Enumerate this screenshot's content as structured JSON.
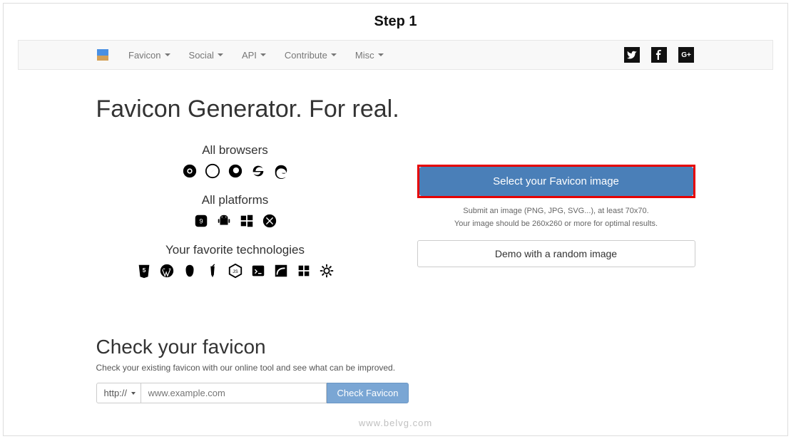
{
  "step_title": "Step 1",
  "nav": {
    "items": [
      "Favicon",
      "Social",
      "API",
      "Contribute",
      "Misc"
    ]
  },
  "main_title": "Favicon Generator. For real.",
  "sections": {
    "browsers": "All browsers",
    "platforms": "All platforms",
    "tech": "Your favorite technologies"
  },
  "action": {
    "select_btn": "Select your Favicon image",
    "hint1": "Submit an image (PNG, JPG, SVG...), at least 70x70.",
    "hint2": "Your image should be 260x260 or more for optimal results.",
    "demo_btn": "Demo with a random image"
  },
  "check": {
    "title": "Check your favicon",
    "sub": "Check your existing favicon with our online tool and see what can be improved.",
    "proto": "http://",
    "placeholder": "www.example.com",
    "btn": "Check Favicon"
  },
  "watermark": "www.belvg.com"
}
